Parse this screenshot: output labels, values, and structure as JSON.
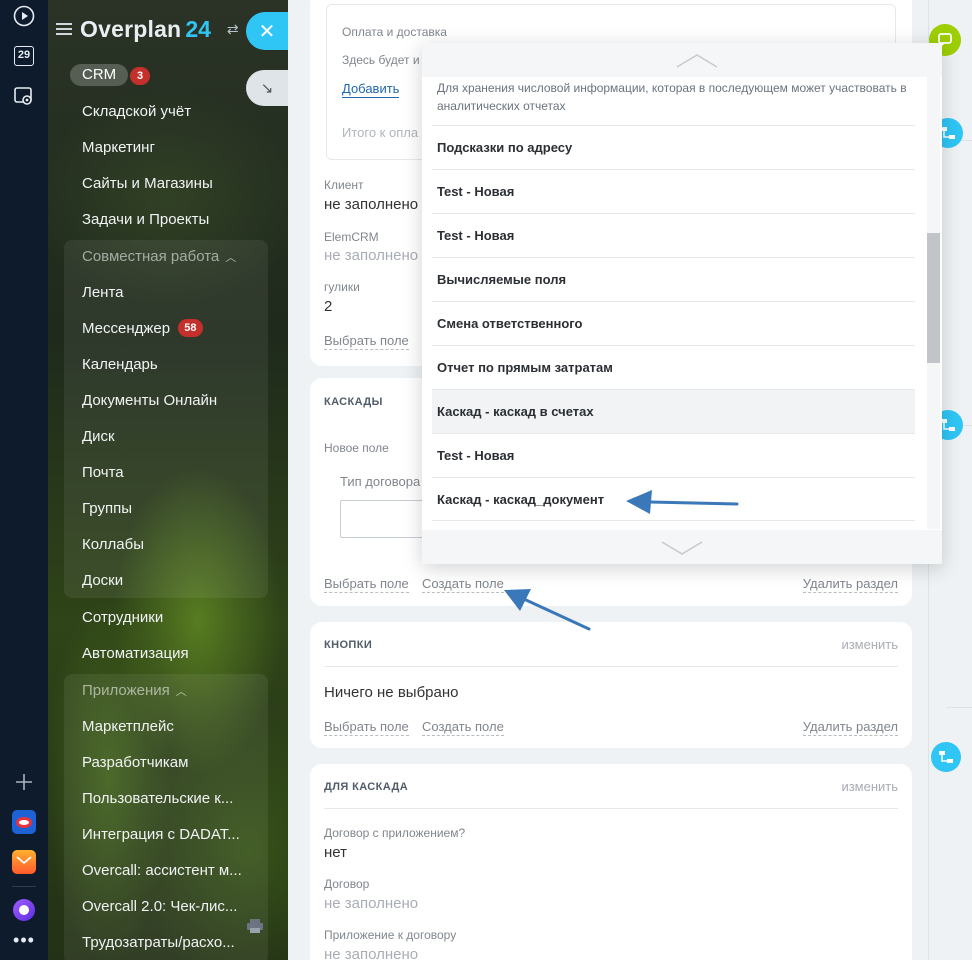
{
  "brand": {
    "name": "Overplan",
    "number": "24"
  },
  "rail": {
    "calendar_day": "29"
  },
  "sidebar": {
    "crm_label": "CRM",
    "crm_count": "3",
    "items_top": [
      "Складской учёт",
      "Маркетинг",
      "Сайты и Магазины",
      "Задачи и Проекты"
    ],
    "group1_title": "Совместная работа",
    "group1_items": [
      "Лента",
      "Мессенджер",
      "Календарь",
      "Документы Онлайн",
      "Диск",
      "Почта",
      "Группы",
      "Коллабы",
      "Доски"
    ],
    "messenger_count": "58",
    "items_mid": [
      "Сотрудники",
      "Автоматизация"
    ],
    "group2_title": "Приложения",
    "group2_items": [
      "Маркетплейс",
      "Разработчикам",
      "Пользовательские к...",
      "Интеграция с DADAT...",
      "Overcall: ассистент м...",
      "Overcall 2.0: Чек-лис...",
      "Трудозатраты/расхо..."
    ]
  },
  "payment_block": {
    "title": "Оплата и доставка",
    "text": "Здесь будет и",
    "add_link": "Добавить",
    "total": "Итого к опла"
  },
  "client_section": {
    "client_label": "Клиент",
    "client_value": "не заполнено",
    "elem_label": "ElemCRM",
    "elem_value": "не заполнено",
    "gulik_label": "гулики",
    "gulik_value": "2",
    "select_field": "Выбрать поле"
  },
  "cascades": {
    "title": "КАСКАДЫ",
    "new_field": "Новое поле",
    "contract_type": "Тип договора",
    "select_field": "Выбрать поле",
    "create_field": "Создать поле",
    "delete_section": "Удалить раздел"
  },
  "buttons_section": {
    "title": "КНОПКИ",
    "edit": "изменить",
    "value": "Ничего не выбрано",
    "select_field": "Выбрать поле",
    "create_field": "Создать поле",
    "delete_section": "Удалить раздел"
  },
  "cascade_section": {
    "title": "ДЛЯ КАСКАДА",
    "edit": "изменить",
    "f1_label": "Договор с приложением?",
    "f1_value": "нет",
    "f2_label": "Договор",
    "f2_value": "не заполнено",
    "f3_label": "Приложение к договору",
    "f3_value": "не заполнено"
  },
  "popup": {
    "description": "Для хранения числовой информации, которая в последующем может участвовать в аналитических отчетах",
    "items": [
      "Подсказки по адресу",
      "Test - Новая",
      "Test - Новая",
      "Вычисляемые поля",
      "Смена ответственного",
      "Отчет по прямым затратам",
      "Каскад - каскад в счетах",
      "Test - Новая",
      "Каскад - каскад_документ"
    ]
  },
  "colors": {
    "accent": "#2fc6f6",
    "badge": "#c4302b",
    "arrow": "#3b78b9",
    "chat": "#9dcf00"
  }
}
